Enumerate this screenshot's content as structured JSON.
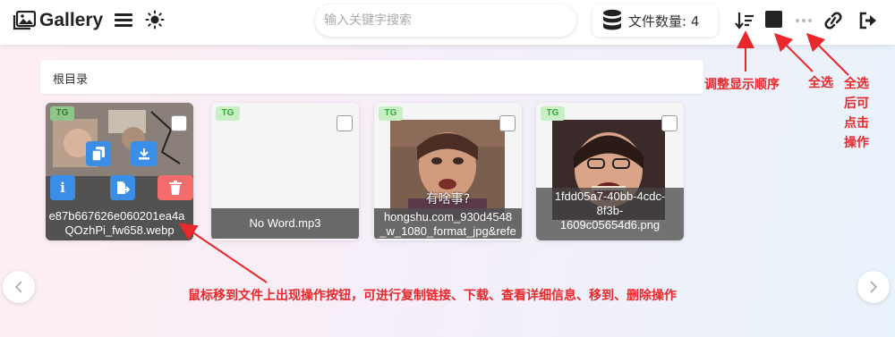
{
  "header": {
    "title": "Gallery",
    "search_placeholder": "输入关键字搜索",
    "file_count_label": "文件数量: 4"
  },
  "breadcrumb": {
    "label": "根目录"
  },
  "files": [
    {
      "tag": "TG",
      "name_line1": "e87b667626e060201ea4a",
      "name_line2": "QOzhPi_fw658.webp"
    },
    {
      "tag": "TG",
      "name_line1": "No Word.mp3"
    },
    {
      "tag": "TG",
      "name_line1": "hongshu.com_930d4548",
      "name_line2": "_w_1080_format_jpg&refe",
      "overlay_text": "有啥事?"
    },
    {
      "tag": "TG",
      "name_line1": "1fdd05a7-40bb-4cdc-",
      "name_line2": "8f3b-",
      "name_line3": "1609c05654d6.png"
    }
  ],
  "annotations": {
    "sort": "调整显示顺序",
    "select_all": "全选",
    "after_select": "全选后可点击操作",
    "hover_tip": "鼠标移到文件上出现操作按钮，可进行复制链接、下载、查看详细信息、移到、删除操作"
  },
  "icons": {
    "logo": "gallery-image-icon",
    "menu": "hamburger-menu-icon",
    "theme": "sun-icon",
    "count": "database-icon",
    "sort": "sort-descending-icon",
    "select_all": "square-select-icon",
    "more": "ellipsis-icon",
    "link": "link-icon",
    "logout": "logout-icon"
  },
  "colors": {
    "accent_blue": "#3a8ee6",
    "delete_red": "#f36d6d",
    "tag_green": "#3aa63a",
    "annotation_red": "#e8282a"
  }
}
